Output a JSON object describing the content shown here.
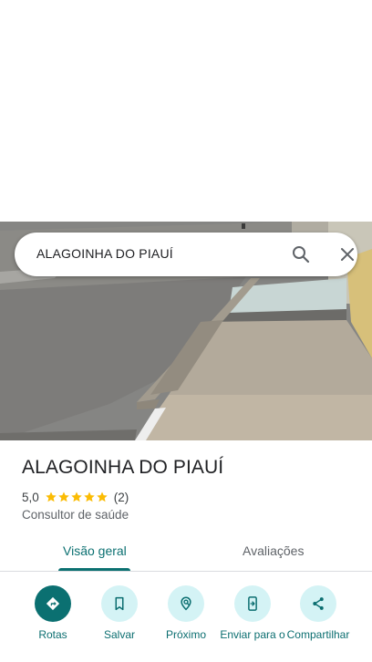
{
  "search": {
    "query": "ALAGOINHA DO PIAUÍ",
    "search_icon": "search-icon",
    "close_icon": "close-icon"
  },
  "place": {
    "title": "ALAGOINHA DO PIAUÍ",
    "rating": "5,0",
    "stars": 5,
    "review_count": "(2)",
    "category": "Consultor de saúde"
  },
  "tabs": [
    {
      "label": "Visão geral",
      "active": true
    },
    {
      "label": "Avaliações",
      "active": false
    }
  ],
  "actions": [
    {
      "label": "Rotas",
      "icon": "directions-icon"
    },
    {
      "label": "Salvar",
      "icon": "bookmark-icon"
    },
    {
      "label": "Próximo",
      "icon": "nearby-icon"
    },
    {
      "label": "Enviar para o",
      "icon": "send-to-phone-icon"
    },
    {
      "label": "Compartilhar",
      "icon": "share-icon"
    }
  ],
  "colors": {
    "accent": "#0b7071",
    "accent_light": "#d4f3f5",
    "star": "#fbbc04"
  }
}
